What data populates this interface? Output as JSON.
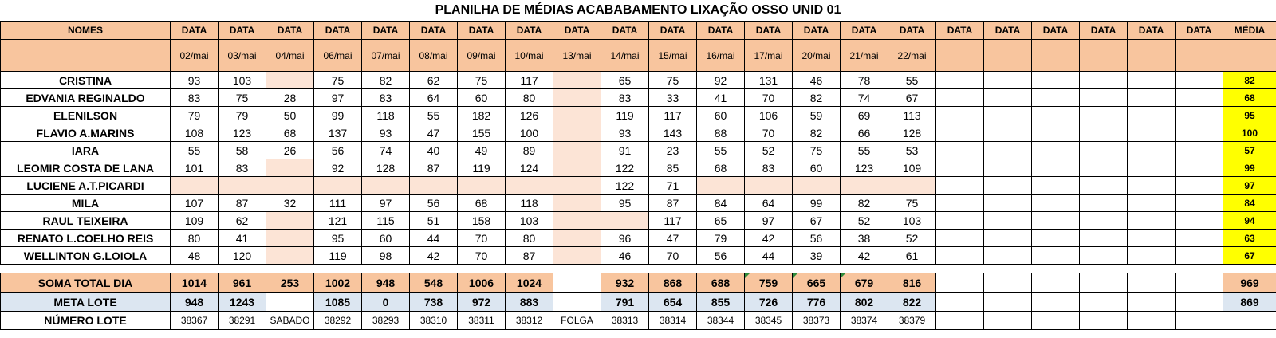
{
  "title": "PLANILHA DE MÉDIAS ACABABAMENTO LIXAÇÃO OSSO UNID 01",
  "header": {
    "names_label": "NOMES",
    "data_label": "DATA",
    "media_label": "MÉDIA",
    "dates": [
      "02/mai",
      "03/mai",
      "04/mai",
      "06/mai",
      "07/mai",
      "08/mai",
      "09/mai",
      "10/mai",
      "13/mai",
      "14/mai",
      "15/mai",
      "16/mai",
      "17/mai",
      "20/mai",
      "21/mai",
      "22/mai",
      "",
      "",
      "",
      "",
      "",
      ""
    ]
  },
  "rows": [
    {
      "name": "CRISTINA",
      "values": [
        "93",
        "103",
        "",
        "75",
        "82",
        "62",
        "75",
        "117",
        "",
        "65",
        "75",
        "92",
        "131",
        "46",
        "78",
        "55"
      ],
      "media": "82"
    },
    {
      "name": "EDVANIA REGINALDO",
      "values": [
        "83",
        "75",
        "28",
        "97",
        "83",
        "64",
        "60",
        "80",
        "",
        "83",
        "33",
        "41",
        "70",
        "82",
        "74",
        "67"
      ],
      "media": "68"
    },
    {
      "name": "ELENILSON",
      "values": [
        "79",
        "79",
        "50",
        "99",
        "118",
        "55",
        "182",
        "126",
        "",
        "119",
        "117",
        "60",
        "106",
        "59",
        "69",
        "113"
      ],
      "media": "95"
    },
    {
      "name": "FLAVIO A.MARINS",
      "values": [
        "108",
        "123",
        "68",
        "137",
        "93",
        "47",
        "155",
        "100",
        "",
        "93",
        "143",
        "88",
        "70",
        "82",
        "66",
        "128"
      ],
      "media": "100"
    },
    {
      "name": "IARA",
      "values": [
        "55",
        "58",
        "26",
        "56",
        "74",
        "40",
        "49",
        "89",
        "",
        "91",
        "23",
        "55",
        "52",
        "75",
        "55",
        "53"
      ],
      "media": "57"
    },
    {
      "name": "LEOMIR COSTA DE LANA",
      "values": [
        "101",
        "83",
        "",
        "92",
        "128",
        "87",
        "119",
        "124",
        "",
        "122",
        "85",
        "68",
        "83",
        "60",
        "123",
        "109"
      ],
      "media": "99"
    },
    {
      "name": "LUCIENE A.T.PICARDI",
      "values": [
        "",
        "",
        "",
        "",
        "",
        "",
        "",
        "",
        "",
        "122",
        "71",
        "",
        "",
        "",
        "",
        ""
      ],
      "media": "97"
    },
    {
      "name": "MILA",
      "values": [
        "107",
        "87",
        "32",
        "111",
        "97",
        "56",
        "68",
        "118",
        "",
        "95",
        "87",
        "84",
        "64",
        "99",
        "82",
        "75"
      ],
      "media": "84"
    },
    {
      "name": "RAUL TEIXEIRA",
      "values": [
        "109",
        "62",
        "",
        "121",
        "115",
        "51",
        "158",
        "103",
        "",
        "",
        "117",
        "65",
        "97",
        "67",
        "52",
        "103"
      ],
      "media": "94"
    },
    {
      "name": "RENATO L.COELHO REIS",
      "values": [
        "80",
        "41",
        "",
        "95",
        "60",
        "44",
        "70",
        "80",
        "",
        "96",
        "47",
        "79",
        "42",
        "56",
        "38",
        "52"
      ],
      "media": "63"
    },
    {
      "name": "WELLINTON G.LOIOLA",
      "values": [
        "48",
        "120",
        "",
        "119",
        "98",
        "42",
        "70",
        "87",
        "",
        "46",
        "70",
        "56",
        "44",
        "39",
        "42",
        "61"
      ],
      "media": "67"
    }
  ],
  "soma": {
    "label": "SOMA TOTAL DIA",
    "values": [
      "1014",
      "961",
      "253",
      "1002",
      "948",
      "548",
      "1006",
      "1024",
      "",
      "932",
      "868",
      "688",
      "759",
      "665",
      "679",
      "816"
    ],
    "media": "969"
  },
  "meta": {
    "label": "META LOTE",
    "values": [
      "948",
      "1243",
      "",
      "1085",
      "0",
      "738",
      "972",
      "883",
      "",
      "791",
      "654",
      "855",
      "726",
      "776",
      "802",
      "822"
    ],
    "media": "869"
  },
  "lote": {
    "label": "NÚMERO LOTE",
    "values": [
      "38367",
      "38291",
      "SABADO",
      "38292",
      "38293",
      "38310",
      "38311",
      "38312",
      "FOLGA",
      "38313",
      "38314",
      "38344",
      "38345",
      "38373",
      "38374",
      "38379"
    ]
  },
  "colors": {
    "header": "#f8c59e",
    "blank": "#fce4d6",
    "average": "#ffff00",
    "meta": "#dce6f1"
  }
}
